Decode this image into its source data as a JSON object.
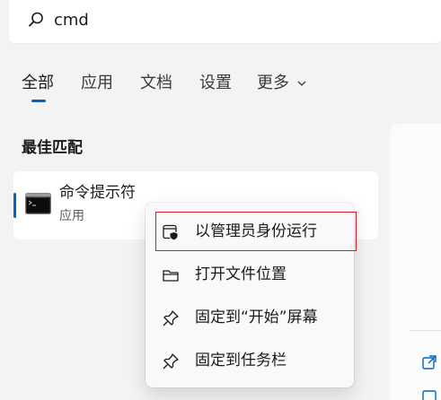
{
  "search": {
    "query": "cmd",
    "icon": "search-icon"
  },
  "tabs": [
    {
      "label": "全部",
      "active": true
    },
    {
      "label": "应用",
      "active": false
    },
    {
      "label": "文档",
      "active": false
    },
    {
      "label": "设置",
      "active": false
    },
    {
      "label": "更多",
      "active": false,
      "icon": "chevron-down-icon"
    }
  ],
  "best_match": {
    "section_title": "最佳匹配",
    "title": "命令提示符",
    "subtitle": "应用",
    "icon": "command-prompt-icon"
  },
  "context_menu": {
    "items": [
      {
        "label": "以管理员身份运行",
        "icon": "run-as-admin-icon",
        "highlighted": true
      },
      {
        "label": "打开文件位置",
        "icon": "folder-icon"
      },
      {
        "label": "固定到“开始”屏幕",
        "icon": "pin-icon"
      },
      {
        "label": "固定到任务栏",
        "icon": "pin-icon"
      }
    ]
  },
  "colors": {
    "accent": "#0067c0",
    "highlight_border": "#d9182b",
    "background": "#f3f3f3"
  }
}
